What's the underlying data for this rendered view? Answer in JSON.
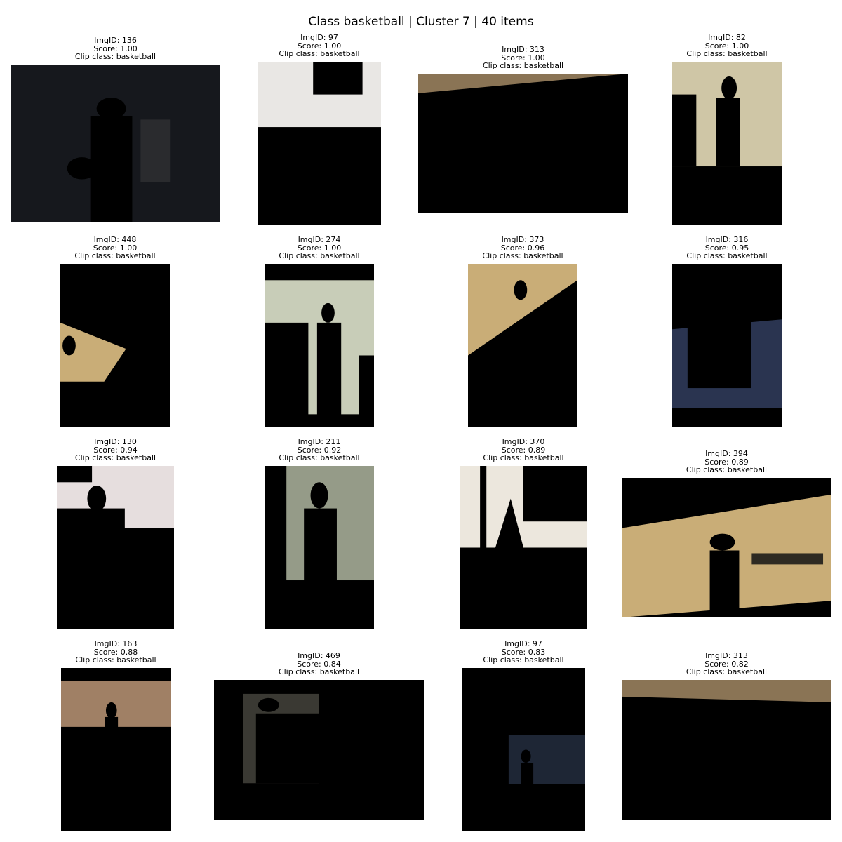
{
  "figure_title": "Class basketball | Cluster 7 | 40 items",
  "labels": {
    "imgid": "ImgID: ",
    "score": "Score: ",
    "clip": "Clip class: "
  },
  "items": [
    {
      "imgid": "136",
      "score": "1.00",
      "clip_class": "basketball"
    },
    {
      "imgid": "97",
      "score": "1.00",
      "clip_class": "basketball"
    },
    {
      "imgid": "313",
      "score": "1.00",
      "clip_class": "basketball"
    },
    {
      "imgid": "82",
      "score": "1.00",
      "clip_class": "basketball"
    },
    {
      "imgid": "448",
      "score": "1.00",
      "clip_class": "basketball"
    },
    {
      "imgid": "274",
      "score": "1.00",
      "clip_class": "basketball"
    },
    {
      "imgid": "373",
      "score": "0.96",
      "clip_class": "basketball"
    },
    {
      "imgid": "316",
      "score": "0.95",
      "clip_class": "basketball"
    },
    {
      "imgid": "130",
      "score": "0.94",
      "clip_class": "basketball"
    },
    {
      "imgid": "211",
      "score": "0.92",
      "clip_class": "basketball"
    },
    {
      "imgid": "370",
      "score": "0.89",
      "clip_class": "basketball"
    },
    {
      "imgid": "394",
      "score": "0.89",
      "clip_class": "basketball"
    },
    {
      "imgid": "163",
      "score": "0.88",
      "clip_class": "basketball"
    },
    {
      "imgid": "469",
      "score": "0.84",
      "clip_class": "basketball"
    },
    {
      "imgid": "97",
      "score": "0.83",
      "clip_class": "basketball"
    },
    {
      "imgid": "313",
      "score": "0.82",
      "clip_class": "basketball"
    }
  ]
}
